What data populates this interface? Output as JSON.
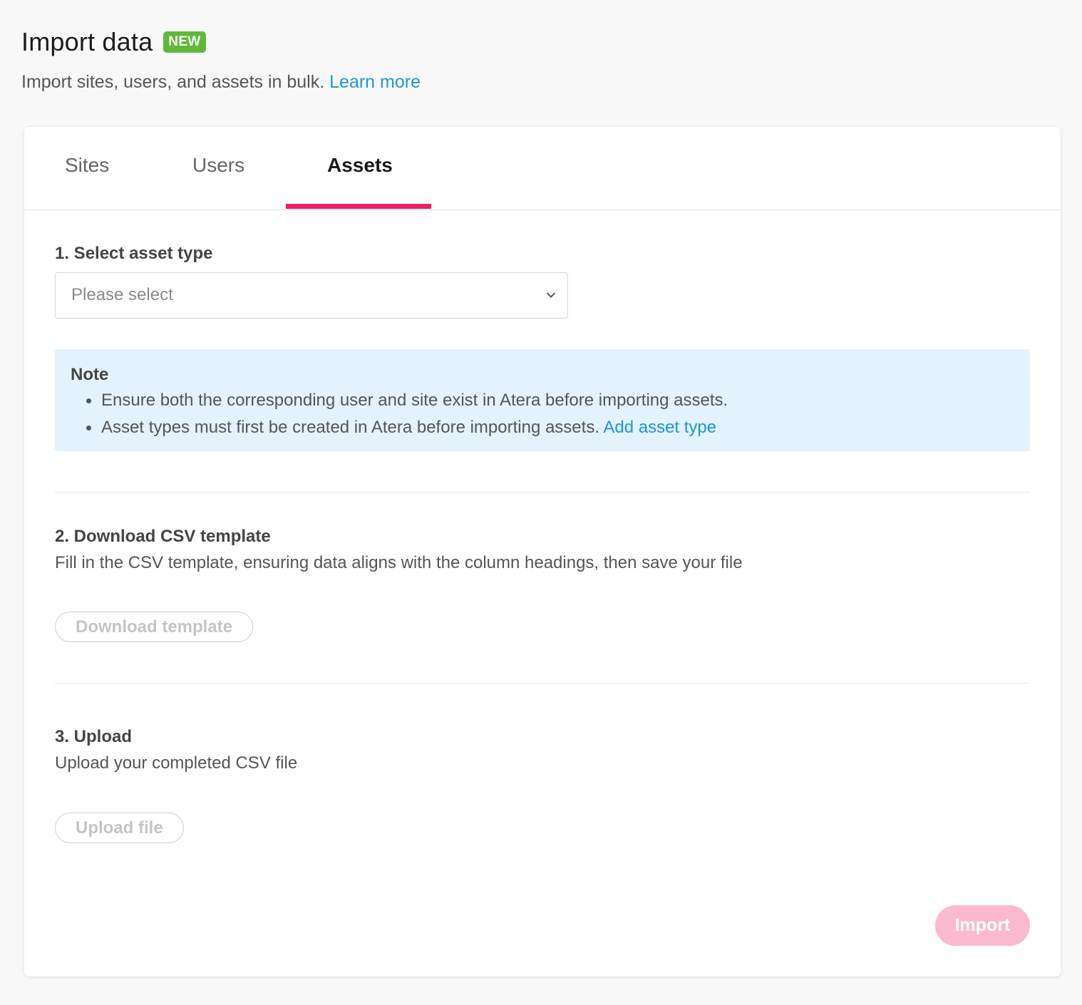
{
  "header": {
    "title": "Import data",
    "badge": "NEW",
    "subtitle": "Import sites, users, and assets in bulk.",
    "learn_more": "Learn more"
  },
  "tabs": [
    {
      "label": "Sites",
      "active": false
    },
    {
      "label": "Users",
      "active": false
    },
    {
      "label": "Assets",
      "active": true
    }
  ],
  "step1": {
    "title": "1. Select asset type",
    "select_placeholder": "Please select"
  },
  "note": {
    "title": "Note",
    "items": [
      "Ensure both the corresponding user and site exist in Atera before importing assets.",
      "Asset types must first be created in Atera before importing assets."
    ],
    "link": "Add asset type"
  },
  "step2": {
    "title": "2. Download CSV template",
    "description": "Fill in the CSV template, ensuring data aligns with the column headings, then save your file",
    "button": "Download template"
  },
  "step3": {
    "title": "3. Upload",
    "description": "Upload your completed CSV file",
    "button": "Upload file"
  },
  "import_button": "Import",
  "colors": {
    "accent": "#ef1f68",
    "link": "#1e95d8",
    "badge": "#5fb83a",
    "note_bg": "#e3f2fc",
    "import_disabled": "#fbb9cf"
  }
}
